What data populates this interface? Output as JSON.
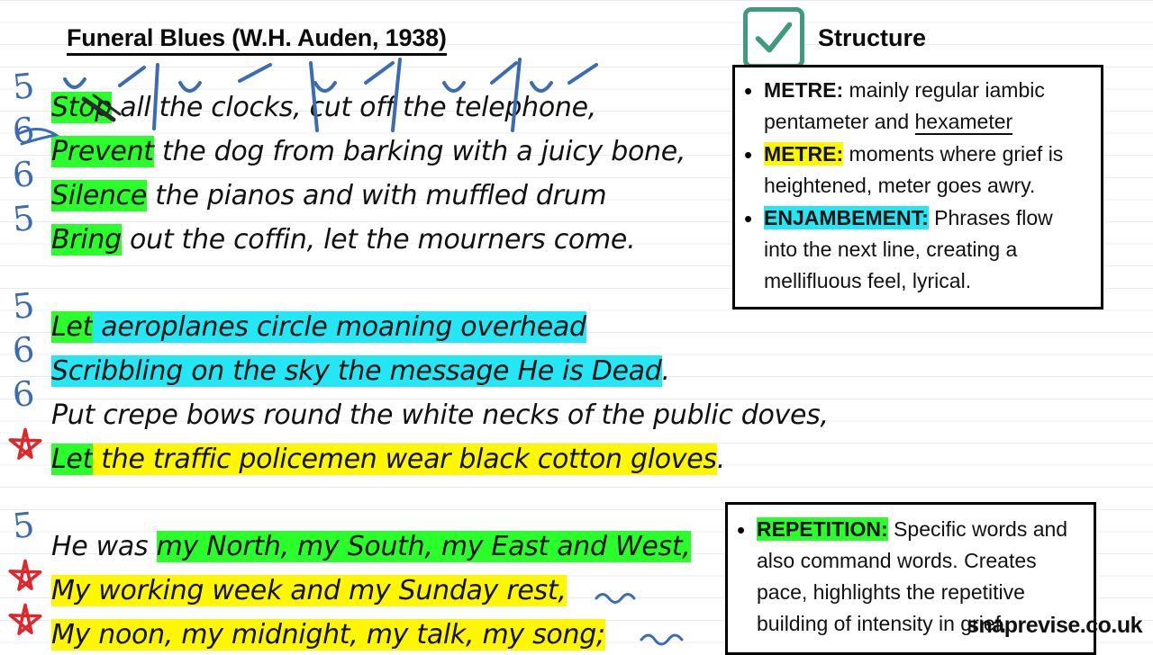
{
  "title": "Funeral Blues (W.H. Auden, 1938)",
  "watermark": "snaprevise.co.uk",
  "poem": {
    "stanzas": [
      {
        "lines": [
          {
            "marker": "5",
            "marker_type": "count",
            "segments": [
              {
                "text": "Stop",
                "highlight": "green"
              },
              {
                "text": " all the clocks, cut off the telephone,",
                "highlight": "none"
              }
            ],
            "plain": "Stop all the clocks, cut off the telephone,"
          },
          {
            "marker": "6",
            "marker_type": "count",
            "segments": [
              {
                "text": "Prevent",
                "highlight": "green"
              },
              {
                "text": " the dog from barking with a juicy bone,",
                "highlight": "none"
              }
            ],
            "plain": "Prevent the dog from barking with a juicy bone,"
          },
          {
            "marker": "6",
            "marker_type": "count",
            "segments": [
              {
                "text": "Silence",
                "highlight": "green"
              },
              {
                "text": " the pianos and with muffled drum",
                "highlight": "none"
              }
            ],
            "plain": "Silence the pianos and with muffled drum"
          },
          {
            "marker": "5",
            "marker_type": "count",
            "segments": [
              {
                "text": "Bring",
                "highlight": "green"
              },
              {
                "text": " out the coffin, let the mourners come.",
                "highlight": "none"
              }
            ],
            "plain": "Bring out the coffin, let the mourners come."
          }
        ]
      },
      {
        "lines": [
          {
            "marker": "5",
            "marker_type": "count",
            "segments": [
              {
                "text": "Let",
                "highlight": "green"
              },
              {
                "text": " aeroplanes circle moaning overhead",
                "highlight": "cyan"
              }
            ],
            "plain": "Let aeroplanes circle moaning overhead"
          },
          {
            "marker": "6",
            "marker_type": "count",
            "segments": [
              {
                "text": "Scribbling on the sky the message He is Dead",
                "highlight": "cyan"
              },
              {
                "text": ".",
                "highlight": "none"
              }
            ],
            "plain": "Scribbling on the sky the message He is Dead."
          },
          {
            "marker": "6",
            "marker_type": "count",
            "segments": [
              {
                "text": "Put crepe bows round the white necks of the public doves,",
                "highlight": "none"
              }
            ],
            "plain": "Put crepe bows round the white necks of the public doves,"
          },
          {
            "marker": "star",
            "marker_type": "star",
            "segments": [
              {
                "text": "Let",
                "highlight": "green"
              },
              {
                "text": " the traffic policemen wear black cotton gloves",
                "highlight": "yellow"
              },
              {
                "text": ".",
                "highlight": "none"
              }
            ],
            "plain": "Let the traffic policemen wear black cotton gloves."
          }
        ]
      },
      {
        "lines": [
          {
            "marker": "5",
            "marker_type": "count",
            "segments": [
              {
                "text": "He was ",
                "highlight": "none"
              },
              {
                "text": "my North, my South, my East and West,",
                "highlight": "green"
              }
            ],
            "plain": "He was my North, my South, my East and West,"
          },
          {
            "marker": "star",
            "marker_type": "star",
            "segments": [
              {
                "text": "My working week and my Sunday rest,",
                "highlight": "yellow"
              }
            ],
            "plain": "My working week and my Sunday rest,"
          },
          {
            "marker": "star",
            "marker_type": "star",
            "segments": [
              {
                "text": "My noon, my midnight, my talk, my song;",
                "highlight": "yellow"
              }
            ],
            "plain": "My noon, my midnight, my talk, my song;"
          }
        ]
      }
    ]
  },
  "structure_panel": {
    "badge_icon": "check-icon",
    "heading": "Structure",
    "bullets": [
      {
        "bullet": "•",
        "keyword": "METRE:",
        "keyword_style": "plain",
        "body": " mainly regular iambic pentameter and hexameter",
        "underlined_word": "hexameter"
      },
      {
        "bullet": "•",
        "keyword": "METRE:",
        "keyword_style": "yellow",
        "body": " moments where grief is heightened, meter goes awry."
      },
      {
        "bullet": "•",
        "keyword": "ENJAMBEMENT:",
        "keyword_style": "cyan",
        "body": " Phrases flow into the next line, creating a mellifluous feel, lyrical."
      }
    ]
  },
  "repetition_panel": {
    "bullets": [
      {
        "bullet": "•",
        "keyword": "REPETITION:",
        "keyword_style": "green",
        "body": " Specific words and also command words. Creates pace, highlights the repetitive building of intensity in grief."
      }
    ]
  },
  "colors": {
    "highlight_green": "#2bff2b",
    "highlight_yellow": "#fff700",
    "highlight_cyan": "#25e6f5",
    "ink_blue": "#3a6bb5",
    "ink_red": "#e0262b",
    "badge_teal": "#3d9b80",
    "rule_gray": "#e9ecef"
  }
}
